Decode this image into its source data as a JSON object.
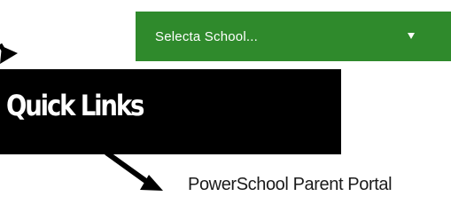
{
  "school_select": {
    "selected_value": "Selecta School...",
    "background_color": "#2f8a2c",
    "caret_icon": "caret-down-icon"
  },
  "quick_links": {
    "heading": "Quick Links",
    "links": [
      {
        "label": "PowerSchool Parent Portal"
      }
    ]
  },
  "annotation_arrows": [
    "arrow-to-school-select",
    "arrow-to-quick-link"
  ]
}
